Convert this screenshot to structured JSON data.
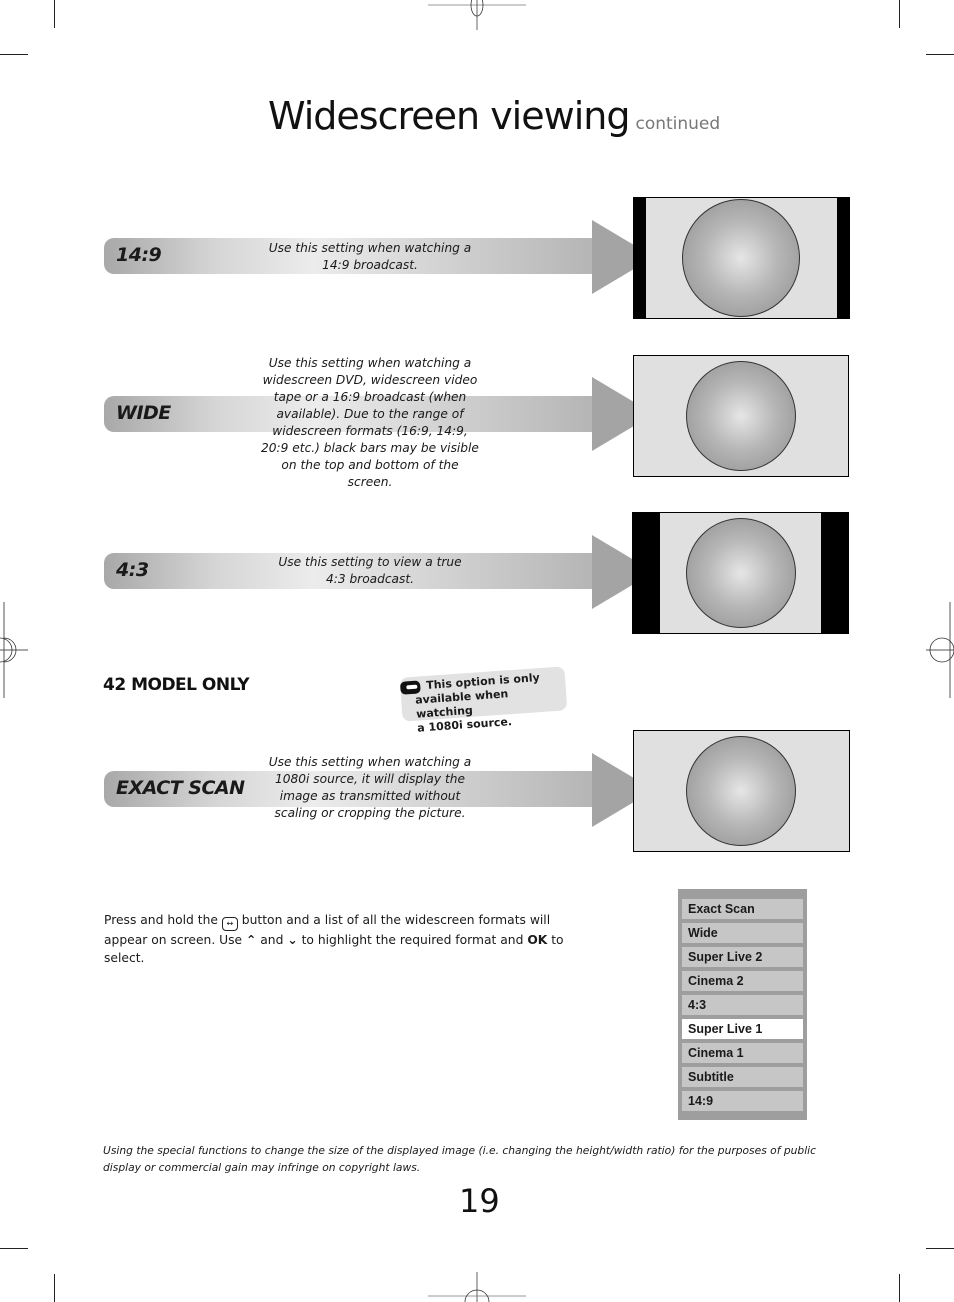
{
  "header": {
    "title": "Widescreen viewing",
    "subtitle": "continued"
  },
  "formats": [
    {
      "label": "14:9",
      "description": "Use this setting when watching a 14:9 broadcast.",
      "screen": "pillarbox-narrow"
    },
    {
      "label": "WIDE",
      "description": "Use this setting when watching a widescreen DVD, widescreen video tape or a 16:9 broadcast (when available). Due to the range of widescreen formats (16:9, 14:9, 20:9 etc.) black bars may be visible on the top and bottom of the screen.",
      "screen": "full"
    },
    {
      "label": "4:3",
      "description": "Use this setting to view a true 4:3 broadcast.",
      "screen": "pillarbox-wide"
    }
  ],
  "model_section": {
    "heading": "42 MODEL ONLY",
    "note_line1": "This option is only",
    "note_line2": "available when watching",
    "note_line3": "a 1080i source.",
    "note_icon": "pointing-hand-icon",
    "format": {
      "label": "EXACT SCAN",
      "description": "Use this setting when watching a 1080i source, it will display the image as transmitted without scaling or cropping the picture.",
      "screen": "full"
    }
  },
  "instructions": {
    "part1": "Press and hold the",
    "button_icon": "widescreen-button-icon",
    "part2": "button and a list of all the widescreen formats will appear on screen. Use",
    "up_icon": "up-arrow-icon",
    "part3": "and",
    "down_icon": "down-arrow-icon",
    "part4": "to highlight the required format and",
    "ok": "OK",
    "part5": "to select."
  },
  "format_menu": {
    "items": [
      "Exact Scan",
      "Wide",
      "Super Live 2",
      "Cinema 2",
      "4:3",
      "Super Live 1",
      "Cinema 1",
      "Subtitle",
      "14:9"
    ],
    "selected": "Super Live 1"
  },
  "footnote": "Using the special functions to change the size of the displayed image (i.e. changing the height/width ratio) for the purposes of public display or commercial gain may infringe on copyright laws.",
  "page_number": "19"
}
